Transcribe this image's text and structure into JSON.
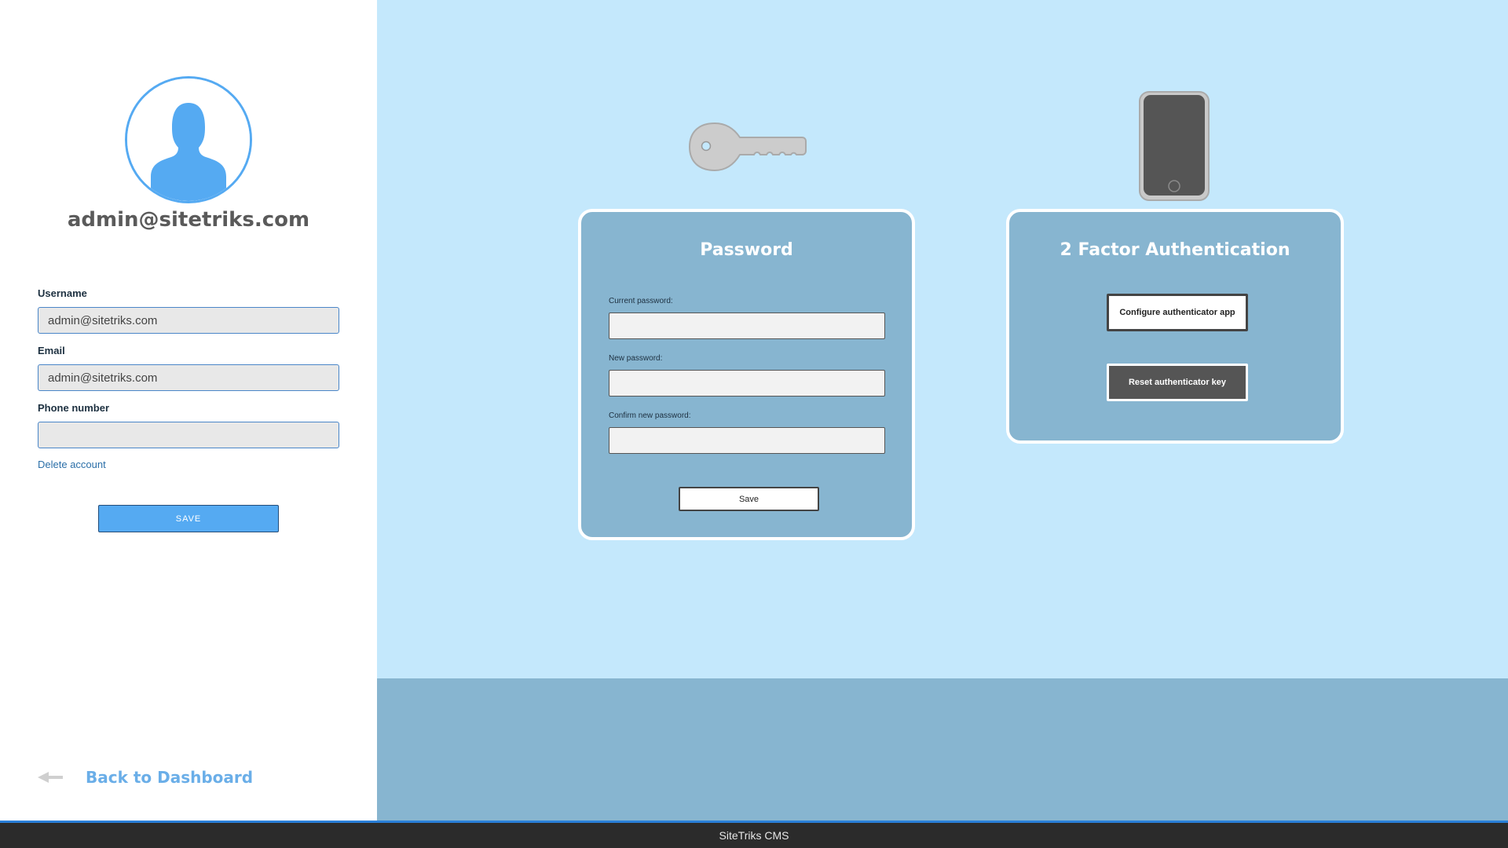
{
  "profile": {
    "display_email": "admin@sitetriks.com",
    "fields": [
      {
        "label": "Username",
        "value": "admin@sitetriks.com"
      },
      {
        "label": "Email",
        "value": "admin@sitetriks.com"
      },
      {
        "label": "Phone number",
        "value": ""
      }
    ],
    "delete_label": "Delete account",
    "save_label": "SAVE",
    "back_label": "Back to Dashboard"
  },
  "password_card": {
    "title": "Password",
    "current_label": "Current password:",
    "new_label": "New password:",
    "confirm_label": "Confirm new password:",
    "save_label": "Save"
  },
  "tfa_card": {
    "title": "2 Factor Authentication",
    "configure_label": "Configure authenticator app",
    "reset_label": "Reset authenticator key"
  },
  "footer": {
    "text": "SiteTriks CMS"
  },
  "icons": {
    "avatar": "user-icon",
    "password": "key-icon",
    "tfa": "phone-icon",
    "back": "arrow-left-icon"
  },
  "colors": {
    "accent": "#55aaf2",
    "panel_bg": "#c4e8fc",
    "card_bg": "#87b5d0",
    "footer_bg": "#2b2b2b"
  }
}
